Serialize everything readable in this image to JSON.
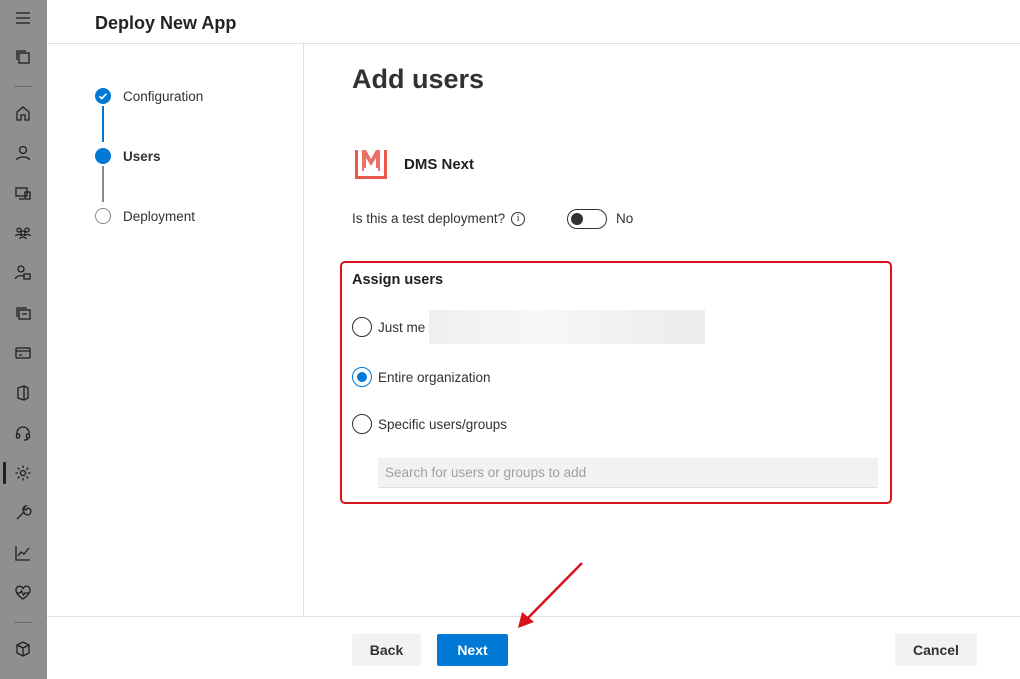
{
  "panel": {
    "title": "Deploy New App"
  },
  "stepper": {
    "steps": [
      {
        "label": "Configuration",
        "state": "done"
      },
      {
        "label": "Users",
        "state": "current"
      },
      {
        "label": "Deployment",
        "state": "todo"
      }
    ]
  },
  "main": {
    "heading": "Add users",
    "app": {
      "name": "DMS Next",
      "icon": "dms-logo-icon"
    },
    "test_deployment": {
      "question": "Is this a test deployment?",
      "info_glyph": "i",
      "toggle_value": "No"
    },
    "assign": {
      "title": "Assign users",
      "options": [
        {
          "label": "Just me",
          "selected": false
        },
        {
          "label": "Entire organization",
          "selected": true
        },
        {
          "label": "Specific users/groups",
          "selected": false
        }
      ],
      "search_placeholder": "Search for users or groups to add"
    }
  },
  "footer": {
    "back_label": "Back",
    "next_label": "Next",
    "cancel_label": "Cancel"
  },
  "colors": {
    "accent": "#0078d4",
    "highlight": "#d9131e",
    "logo": "#e8574a"
  },
  "rail_icons": [
    "menu-icon",
    "copy-icon",
    "home-icon",
    "user-icon",
    "devices-icon",
    "groups-icon",
    "roles-icon",
    "resources-icon",
    "billing-icon",
    "office-icon",
    "support-icon",
    "settings-icon",
    "setup-icon",
    "reports-icon",
    "health-icon",
    "admin-centers-icon"
  ]
}
